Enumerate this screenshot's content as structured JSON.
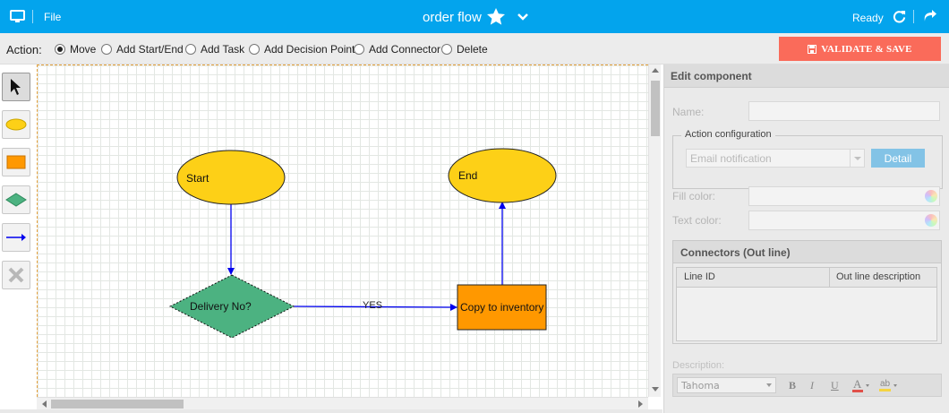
{
  "topbar": {
    "file_label": "File",
    "title": "order flow",
    "status": "Ready",
    "icons": [
      "monitor-icon",
      "star-icon",
      "chevron-down-icon",
      "refresh-icon",
      "share-icon"
    ]
  },
  "actionbar": {
    "label": "Action:",
    "options": [
      {
        "label": "Move",
        "selected": true
      },
      {
        "label": "Add Start/End",
        "selected": false
      },
      {
        "label": "Add Task",
        "selected": false
      },
      {
        "label": "Add Decision Point",
        "selected": false
      },
      {
        "label": "Add Connector",
        "selected": false
      },
      {
        "label": "Delete",
        "selected": false
      }
    ],
    "validate_label": "VALIDATE & SAVE"
  },
  "toolbox": {
    "tools": [
      "pointer-icon",
      "ellipse-icon",
      "rectangle-icon",
      "diamond-icon",
      "connector-arrow-icon",
      "delete-x-icon"
    ]
  },
  "diagram": {
    "nodes": {
      "start": {
        "label": "Start",
        "shape": "ellipse",
        "color": "#fdd017"
      },
      "end": {
        "label": "End",
        "shape": "ellipse",
        "color": "#fdd017"
      },
      "decision": {
        "label": "Delivery No?",
        "shape": "diamond",
        "color": "#4cb281"
      },
      "task": {
        "label": "Copy to inventory",
        "shape": "rectangle",
        "color": "#ff9800"
      }
    },
    "edges": [
      {
        "from": "start",
        "to": "decision",
        "label": ""
      },
      {
        "from": "decision",
        "to": "task",
        "label": "YES"
      },
      {
        "from": "task",
        "to": "end",
        "label": ""
      }
    ],
    "edge_color": "#0000ee"
  },
  "panel": {
    "title": "Edit component",
    "name_label": "Name:",
    "action_config_label": "Action configuration",
    "action_select_value": "Email notification",
    "detail_label": "Detail",
    "fill_color_label": "Fill color:",
    "text_color_label": "Text color:",
    "connectors_title": "Connectors (Out line)",
    "columns": [
      "Line ID",
      "Out line description"
    ],
    "description_label": "Description:",
    "font_value": "Tahoma",
    "format_buttons": [
      "B",
      "I",
      "U"
    ]
  },
  "colors": {
    "topbar": "#03a4ed",
    "validate": "#fa6b5a",
    "detail": "#83c3e6"
  }
}
